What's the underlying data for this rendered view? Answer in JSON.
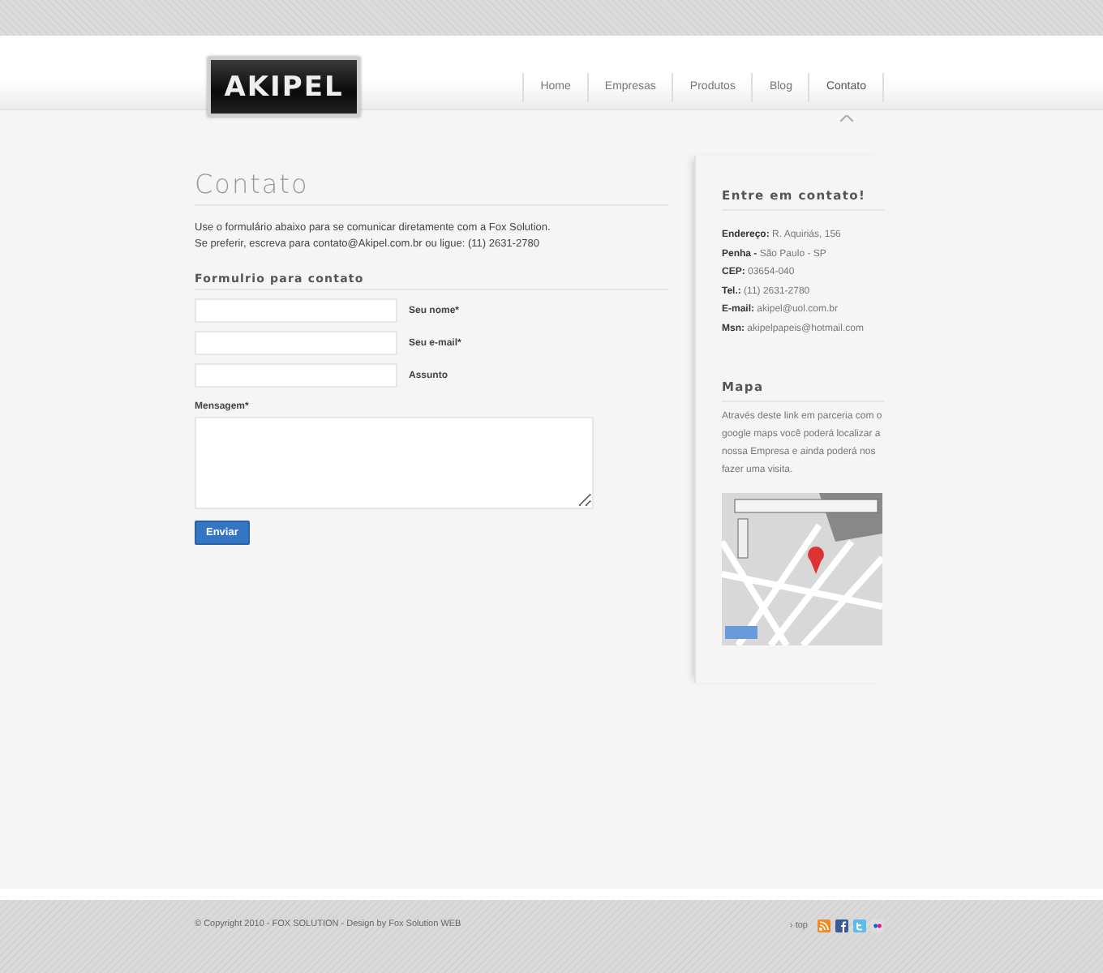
{
  "logo": {
    "text": "AKIPEL"
  },
  "nav": [
    {
      "label": "Home",
      "selected": false
    },
    {
      "label": "Empresas",
      "selected": false
    },
    {
      "label": "Produtos",
      "selected": false
    },
    {
      "label": "Blog",
      "selected": false
    },
    {
      "label": "Contato",
      "selected": true
    }
  ],
  "page": {
    "title": "Contato",
    "intro": [
      "Use o formulário abaixo para se comunicar diretamente com a Fox Solution.",
      "Se preferir, escreva para contato@Akipel.com.br ou ligue: (11) 2631-2780"
    ]
  },
  "form": {
    "title": "Formulrio para contato",
    "fields": [
      {
        "label": "Seu nome*"
      },
      {
        "label": "Seu e-mail*"
      },
      {
        "label": "Assunto"
      }
    ],
    "message_label": "Mensagem*",
    "submit": "Enviar"
  },
  "sidebar": {
    "contact_title": "Entre em contato!",
    "contact_lines": [
      "**Endereço:** R. Aquiriás, 156",
      "**Penha -** São Paulo - SP",
      "**CEP:** 03654-040",
      "**Tel.:** (11) 2631-2780",
      "**E-mail:** akipel@uol.com.br",
      "**Msn:** akipelpapeis@hotmail.com"
    ],
    "map_title": "Mapa",
    "map_text": "Através deste link em parceria com o google maps você poderá localizar a nossa Empresa e ainda poderá nos fazer uma visita."
  },
  "footer": {
    "copyright": "© Copyright 2010 - FOX SOLUTION - Design by Fox Solution WEB",
    "top_link": "› top"
  }
}
